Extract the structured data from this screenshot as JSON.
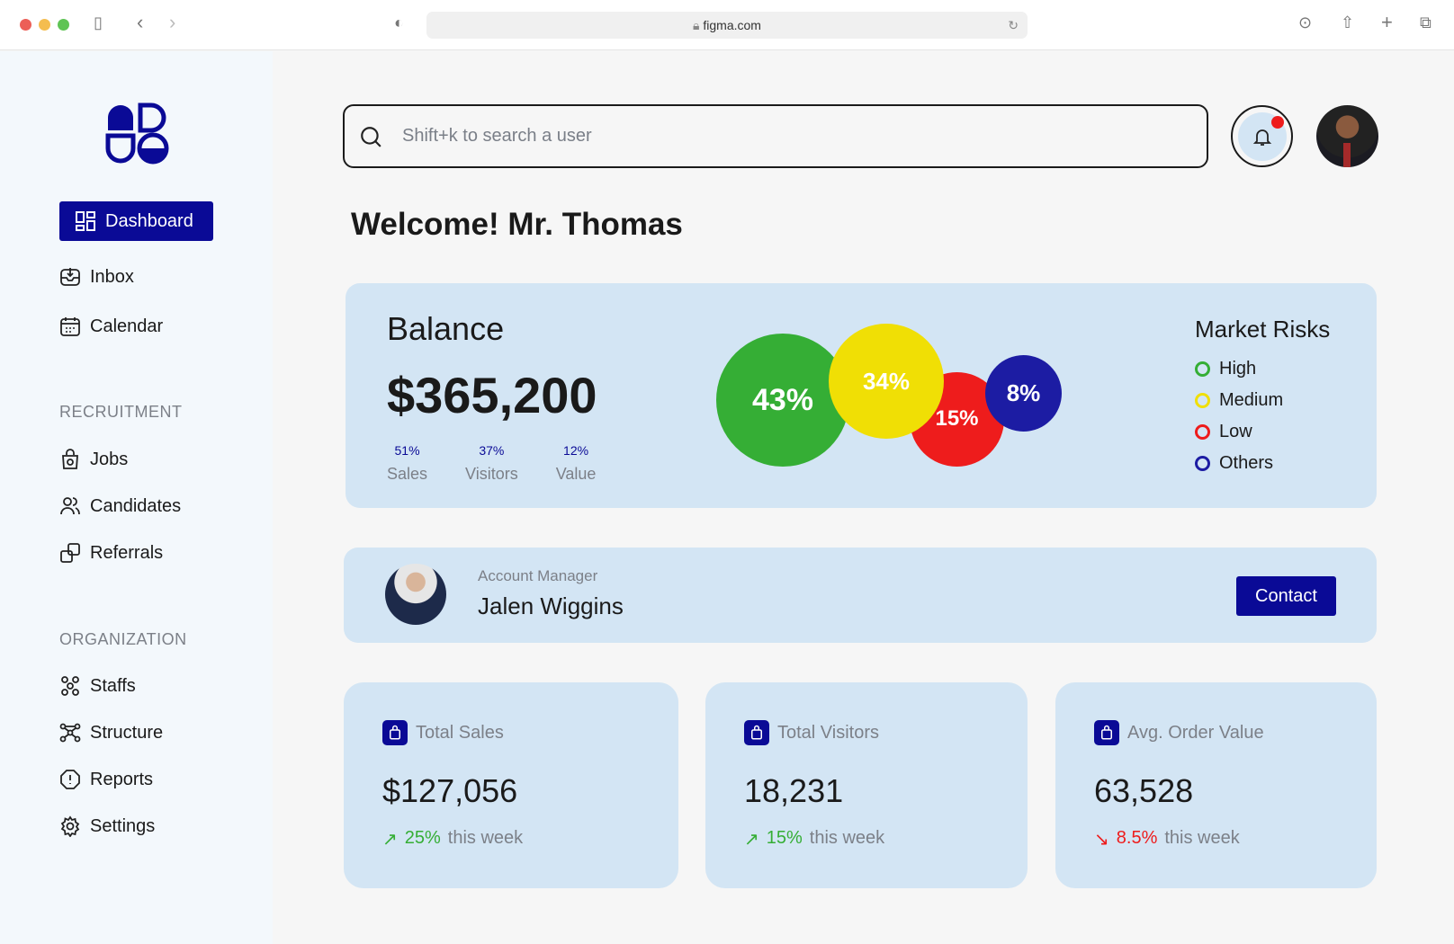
{
  "browser": {
    "url": "figma.com"
  },
  "sidebar": {
    "dashboard": "Dashboard",
    "main": [
      {
        "label": "Inbox"
      },
      {
        "label": "Calendar"
      }
    ],
    "recruitment_title": "RECRUITMENT",
    "recruitment": [
      {
        "label": "Jobs"
      },
      {
        "label": "Candidates"
      },
      {
        "label": "Referrals"
      }
    ],
    "organization_title": "ORGANIZATION",
    "organization": [
      {
        "label": "Staffs"
      },
      {
        "label": "Structure"
      },
      {
        "label": "Reports"
      },
      {
        "label": "Settings"
      }
    ]
  },
  "search": {
    "placeholder": "Shift+k to search a user"
  },
  "welcome": "Welcome! Mr. Thomas",
  "balance": {
    "title": "Balance",
    "amount": "$365,200",
    "breakdown": [
      {
        "pct": "51%",
        "label": "Sales"
      },
      {
        "pct": "37%",
        "label": "Visitors"
      },
      {
        "pct": "12%",
        "label": "Value"
      }
    ]
  },
  "chart_data": {
    "type": "bubble",
    "title": "Market Risks",
    "series": [
      {
        "name": "High",
        "value": 43,
        "label": "43%",
        "color": "#35ae35"
      },
      {
        "name": "Medium",
        "value": 34,
        "label": "34%",
        "color": "#f0df05"
      },
      {
        "name": "Low",
        "value": 15,
        "label": "15%",
        "color": "#ee1c1c"
      },
      {
        "name": "Others",
        "value": 8,
        "label": "8%",
        "color": "#1c1ca3"
      }
    ]
  },
  "manager": {
    "role": "Account Manager",
    "name": "Jalen Wiggins",
    "contact": "Contact"
  },
  "stats": [
    {
      "title": "Total Sales",
      "value": "$127,056",
      "change": "25%",
      "arrow": "↗",
      "suffix": "this week",
      "color": "#35ae35"
    },
    {
      "title": "Total Visitors",
      "value": "18,231",
      "change": "15%",
      "arrow": "↗",
      "suffix": "this week",
      "color": "#35ae35"
    },
    {
      "title": "Avg. Order Value",
      "value": "63,528",
      "change": "8.5%",
      "arrow": "↘",
      "suffix": "this week",
      "color": "#ee1c1c"
    }
  ]
}
